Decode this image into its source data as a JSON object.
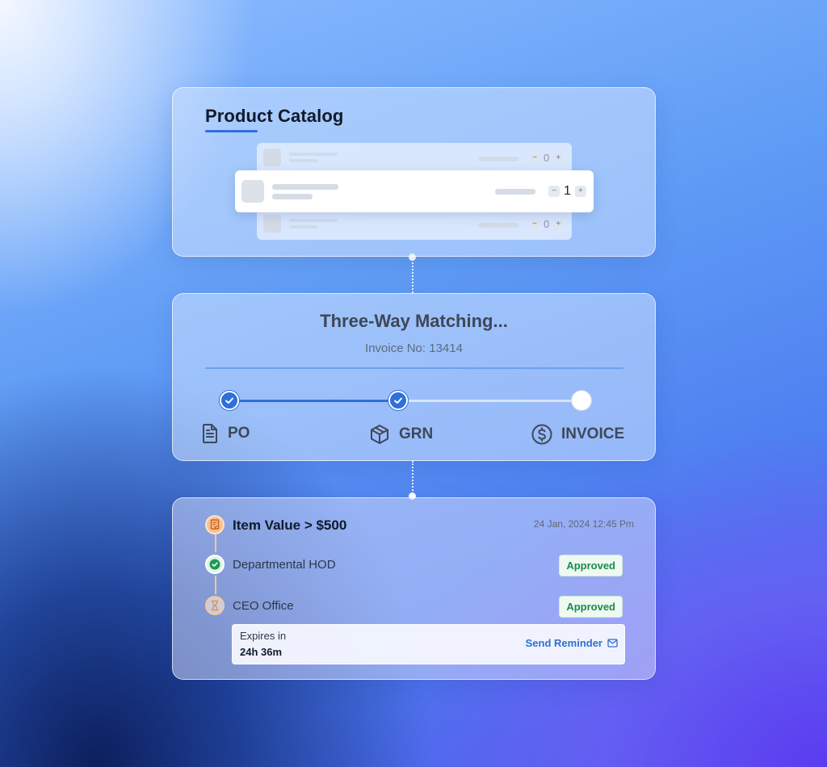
{
  "catalog": {
    "title": "Product Catalog",
    "rows": [
      {
        "quantity": "0",
        "minus": "−",
        "plus": "+"
      },
      {
        "quantity": "1",
        "minus": "−",
        "plus": "+"
      },
      {
        "quantity": "0",
        "minus": "−",
        "plus": "+"
      }
    ]
  },
  "matching": {
    "title": "Three-Way Matching...",
    "invoice_label": "Invoice No: 13414",
    "steps": [
      {
        "label": "PO",
        "icon": "document-icon",
        "status": "done"
      },
      {
        "label": "GRN",
        "icon": "package-icon",
        "status": "done"
      },
      {
        "label": "INVOICE",
        "icon": "dollar-circle-icon",
        "status": "pending"
      }
    ],
    "accent": "#2e6fdc"
  },
  "approval": {
    "rule": "Item Value > $500",
    "timestamp": "24 Jan, 2024 12:45 Pm",
    "approvers": [
      {
        "name": "Departmental HOD",
        "status": "Approved",
        "icon": "check-circle-icon"
      },
      {
        "name": "CEO Office",
        "status": "Approved",
        "icon": "hourglass-icon"
      }
    ],
    "expiry_label": "Expires in",
    "expiry_value": "24h 36m",
    "reminder_label": "Send Reminder",
    "approved_color": "#1c8a4a"
  }
}
